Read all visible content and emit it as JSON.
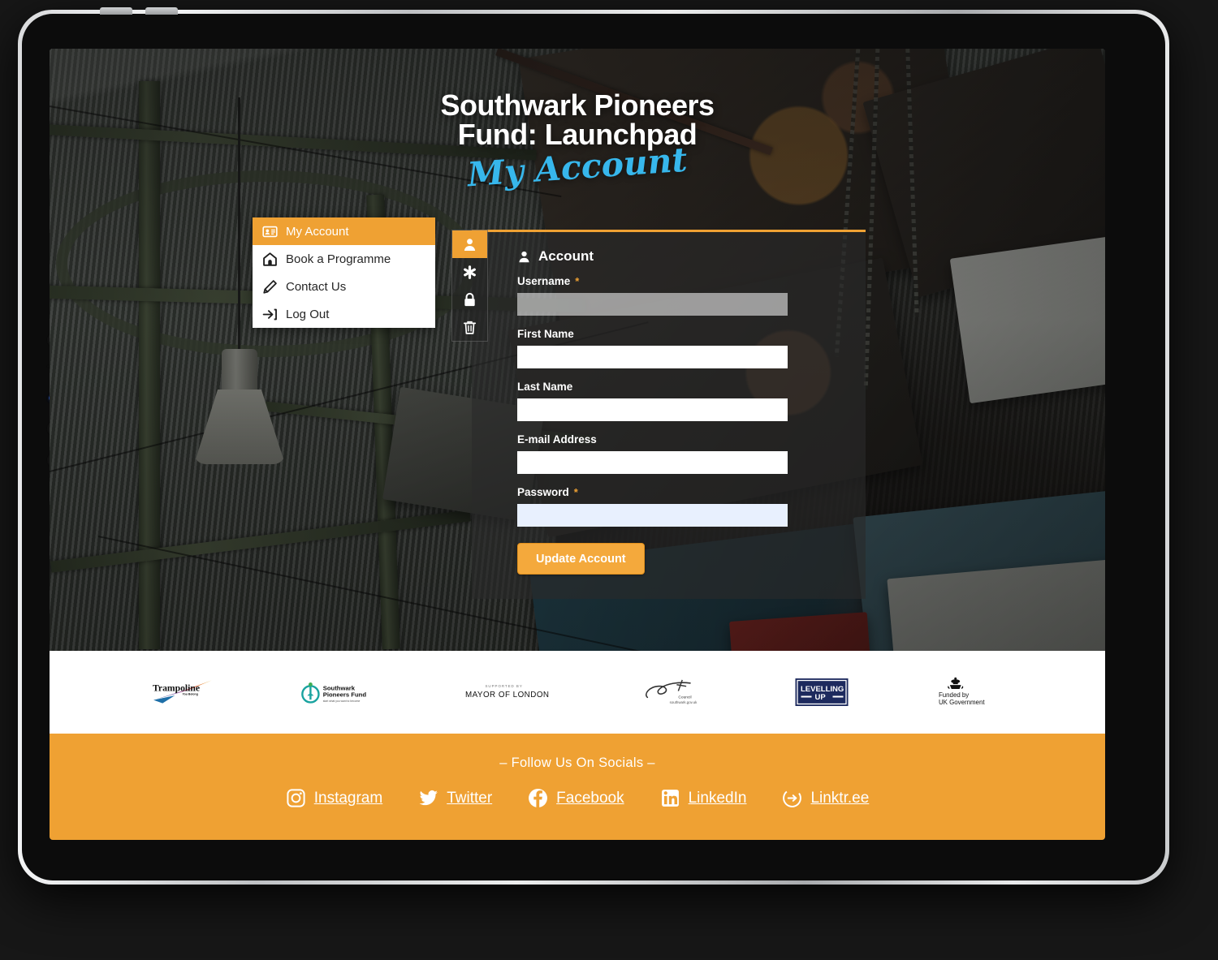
{
  "hero": {
    "title_line1": "Southwark Pioneers",
    "title_line2": "Fund: Launchpad",
    "script_title": "My Account"
  },
  "nav_menu": {
    "items": [
      {
        "label": "My Account",
        "icon": "id-card-icon",
        "active": true
      },
      {
        "label": "Book a Programme",
        "icon": "home-icon",
        "active": false
      },
      {
        "label": "Contact Us",
        "icon": "pencil-icon",
        "active": false
      },
      {
        "label": "Log Out",
        "icon": "logout-arrow-icon",
        "active": false
      }
    ]
  },
  "icon_rail": {
    "items": [
      {
        "icon": "person-icon",
        "active": true
      },
      {
        "icon": "asterisk-icon",
        "active": false
      },
      {
        "icon": "lock-icon",
        "active": false
      },
      {
        "icon": "trash-icon",
        "active": false
      }
    ]
  },
  "account_form": {
    "heading": "Account",
    "heading_icon": "person-icon",
    "fields": [
      {
        "label": "Username",
        "required": true,
        "value": "",
        "state": "disabled"
      },
      {
        "label": "First Name",
        "required": false,
        "value": "",
        "state": "normal"
      },
      {
        "label": "Last Name",
        "required": false,
        "value": "",
        "state": "normal"
      },
      {
        "label": "E-mail Address",
        "required": false,
        "value": "",
        "state": "normal"
      },
      {
        "label": "Password",
        "required": true,
        "value": "",
        "state": "autofill"
      }
    ],
    "required_marker": "*",
    "submit_label": "Update Account"
  },
  "logo_strip": {
    "logos": [
      {
        "name": "trampoline-logo",
        "text": "Trampoline",
        "subtext": "You Belong"
      },
      {
        "name": "southwark-pioneers-logo",
        "text": "Southwark\nPioneers Fund",
        "subtext": "start what you want to become"
      },
      {
        "name": "mayor-of-london-logo",
        "text": "MAYOR OF LONDON",
        "subtext": "SUPPORTED BY"
      },
      {
        "name": "southwark-council-logo",
        "text": "Southwark",
        "subtext": "Council\nsouthwark.gov.uk"
      },
      {
        "name": "levelling-up-logo",
        "text": "LEVELLING",
        "subtext": "UP"
      },
      {
        "name": "uk-government-logo",
        "text": "Funded by",
        "subtext": "UK Government"
      }
    ]
  },
  "social_footer": {
    "title": "– Follow Us On Socials –",
    "links": [
      {
        "label": "Instagram",
        "icon": "instagram-icon"
      },
      {
        "label": "Twitter",
        "icon": "twitter-icon"
      },
      {
        "label": "Facebook",
        "icon": "facebook-icon"
      },
      {
        "label": "LinkedIn",
        "icon": "linkedin-icon"
      },
      {
        "label": "Linktr.ee",
        "icon": "linktree-icon"
      }
    ]
  },
  "colors": {
    "brand_orange": "#efa133",
    "script_cyan": "#37b7ec",
    "panel_dark": "rgba(42,42,42,.62)",
    "autofill_blue": "#e8f0fe",
    "levelling_navy": "#1d2a5e"
  }
}
